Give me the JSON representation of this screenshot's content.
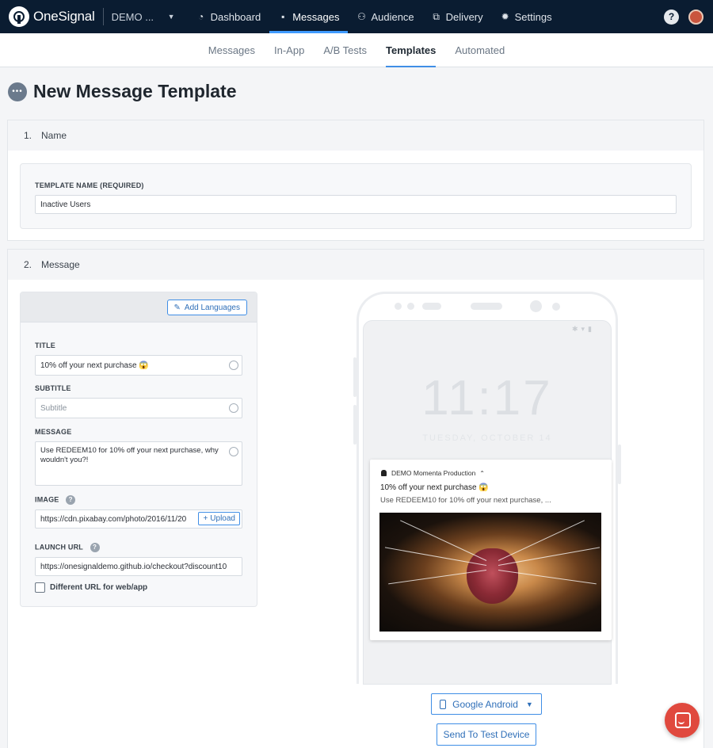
{
  "app": {
    "brand": "OneSignal",
    "app_select": "DEMO ..."
  },
  "topnav": {
    "items": [
      {
        "label": "Dashboard",
        "icon": "dashboard-icon"
      },
      {
        "label": "Messages",
        "icon": "messages-icon"
      },
      {
        "label": "Audience",
        "icon": "audience-icon"
      },
      {
        "label": "Delivery",
        "icon": "delivery-icon"
      },
      {
        "label": "Settings",
        "icon": "settings-icon"
      }
    ],
    "active": "Messages",
    "help": "?"
  },
  "subnav": {
    "tabs": [
      "Messages",
      "In-App",
      "A/B Tests",
      "Templates",
      "Automated"
    ],
    "active": "Templates"
  },
  "page": {
    "title": "New Message Template"
  },
  "section_name": {
    "number": "1.",
    "title": "Name",
    "field_label": "TEMPLATE NAME (REQUIRED)",
    "field_value": "Inactive Users"
  },
  "section_message": {
    "number": "2.",
    "title": "Message",
    "add_languages": "Add Languages",
    "title_label": "TITLE",
    "title_value": "10% off your next purchase 😱",
    "subtitle_label": "SUBTITLE",
    "subtitle_placeholder": "Subtitle",
    "message_label": "MESSAGE",
    "message_value": "Use REDEEM10 for 10% off your next purchase, why wouldn't you?!",
    "image_label": "IMAGE",
    "image_value": "https://cdn.pixabay.com/photo/2016/11/20",
    "upload_label": "Upload",
    "launch_url_label": "LAUNCH URL",
    "launch_url_value": "https://onesignaldemo.github.io/checkout?discount10",
    "different_url_label": "Different URL for web/app"
  },
  "preview": {
    "clock": "11:17",
    "date": "TUESDAY, OCTOBER 14",
    "notification": {
      "app_name": "DEMO Momenta Production",
      "title": "10% off your next purchase 😱",
      "body": "Use REDEEM10 for 10% off your next purchase, ..."
    },
    "platform": "Google Android",
    "send_test": "Send To Test Device"
  },
  "colors": {
    "nav_bg": "#0a1c31",
    "accent": "#3f8ee6",
    "chat_bubble": "#e0493e"
  }
}
